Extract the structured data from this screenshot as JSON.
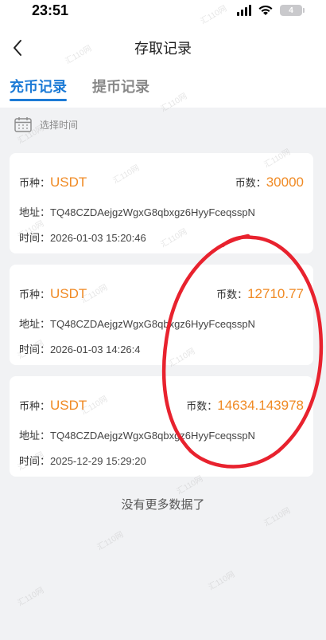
{
  "status_bar": {
    "time": "23:51",
    "battery": "4"
  },
  "header": {
    "title": "存取记录"
  },
  "tabs": [
    {
      "label": "充币记录",
      "active": true
    },
    {
      "label": "提币记录",
      "active": false
    }
  ],
  "filter": {
    "label": "选择时间"
  },
  "records": [
    {
      "coin_label": "币种：",
      "coin": "USDT",
      "amount_label": "币数：",
      "amount": "30000",
      "address_label": "地址：",
      "address": "TQ48CZDAejgzWgxG8qbxgz6HyyFceqsspN",
      "time_label": "时间：",
      "time": "2026-01-03 15:20:46"
    },
    {
      "coin_label": "币种：",
      "coin": "USDT",
      "amount_label": "币数：",
      "amount": "12710.77",
      "address_label": "地址：",
      "address": "TQ48CZDAejgzWgxG8qbxgz6HyyFceqsspN",
      "time_label": "时间：",
      "time": "2026-01-03 14:26:4"
    },
    {
      "coin_label": "币种：",
      "coin": "USDT",
      "amount_label": "币数：",
      "amount": "14634.143978",
      "address_label": "地址：",
      "address": "TQ48CZDAejgzWgxG8qbxgz6HyyFceqsspN",
      "time_label": "时间：",
      "time": "2025-12-29 15:29:20"
    }
  ],
  "footer": {
    "no_more": "没有更多数据了"
  },
  "watermark": "汇110网",
  "colors": {
    "accent_blue": "#1d7bd6",
    "amount_orange": "#f08a24",
    "annotation_red": "#e8222e"
  }
}
